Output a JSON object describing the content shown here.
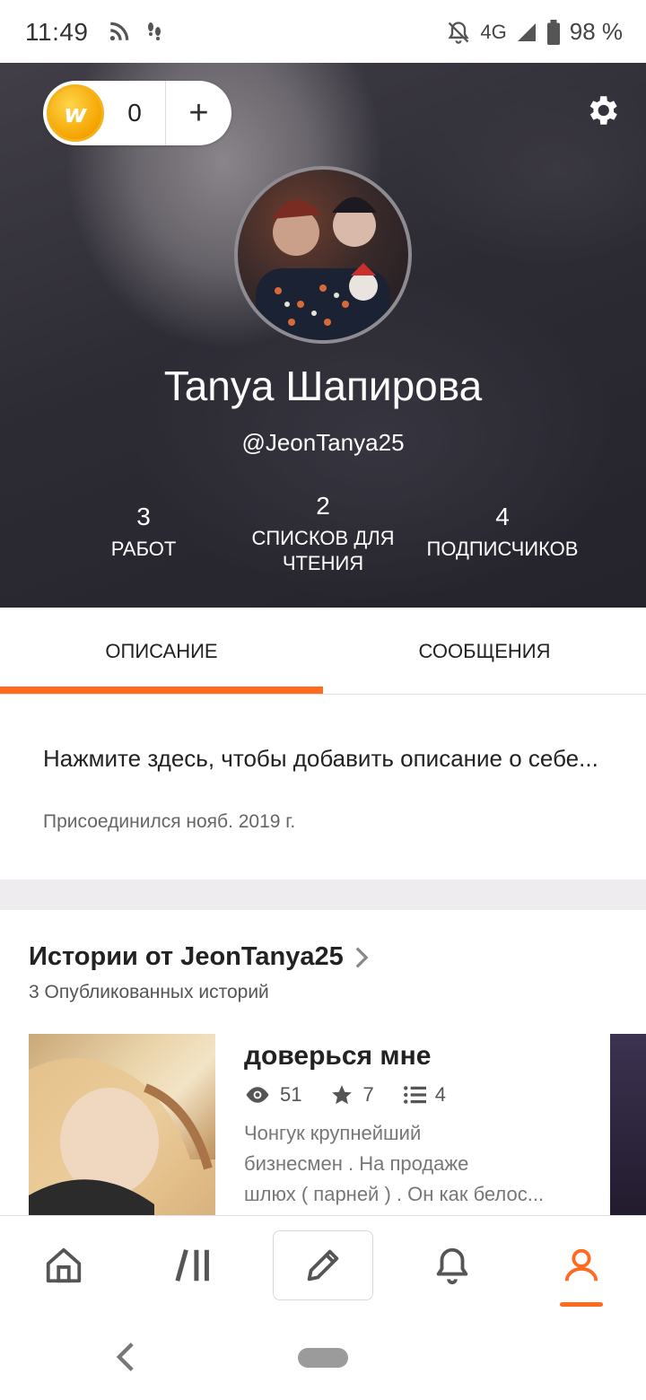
{
  "status_bar": {
    "time": "11:49",
    "network": "4G",
    "battery": "98 %",
    "icons": [
      "rss-icon",
      "footsteps-icon",
      "bell-off-icon",
      "signal-icon",
      "battery-icon"
    ]
  },
  "header": {
    "coins": "0",
    "coin_symbol": "w",
    "add_symbol": "+",
    "display_name": "Tanya Шапирова",
    "username": "@JeonTanya25",
    "stats": [
      {
        "value": "3",
        "label": "РАБОТ"
      },
      {
        "value": "2",
        "label": "СПИСКОВ ДЛЯ ЧТЕНИЯ"
      },
      {
        "value": "4",
        "label": "ПОДПИСЧИКОВ"
      }
    ]
  },
  "tabs": [
    {
      "label": "ОПИСАНИЕ",
      "active": true
    },
    {
      "label": "СООБЩЕНИЯ",
      "active": false
    }
  ],
  "about": {
    "placeholder": "Нажмите здесь, чтобы добавить описание о себе...",
    "joined": "Присоединился нояб. 2019 г."
  },
  "stories": {
    "title": "Истории от JeonTanya25",
    "subtitle": "3 Опубликованных историй",
    "items": [
      {
        "title": "доверься мне",
        "views": "51",
        "votes": "7",
        "parts": "4",
        "description_lines": [
          "Чонгук крупнейший",
          "бизнесмен . На продаже",
          "шлюх ( парней ) . Он как белос..."
        ]
      }
    ]
  },
  "bottom_nav": {
    "items": [
      "home-icon",
      "library-icon",
      "write-icon",
      "notifications-icon",
      "profile-icon"
    ],
    "active": "profile-icon"
  },
  "colors": {
    "accent": "#ff6a1f",
    "coin": "#f5a400"
  }
}
